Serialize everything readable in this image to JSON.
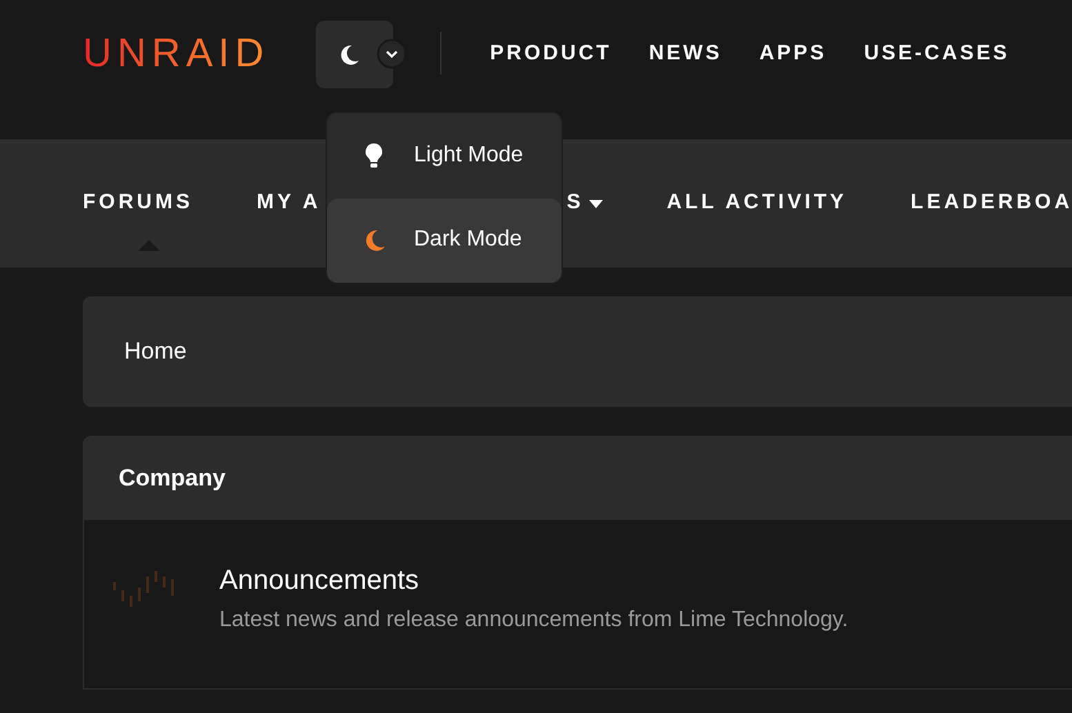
{
  "header": {
    "logo": "UNRAID",
    "nav": [
      "PRODUCT",
      "NEWS",
      "APPS",
      "USE-CASES"
    ]
  },
  "theme_menu": {
    "items": [
      {
        "kind": "light",
        "label": "Light Mode",
        "selected": false
      },
      {
        "kind": "dark",
        "label": "Dark Mode",
        "selected": true
      }
    ]
  },
  "subnav": [
    {
      "label_start": "FORUMS",
      "selected": true
    },
    {
      "label_start": "MY A",
      "label_end": "S",
      "caret": true,
      "selected": false
    },
    {
      "label_start": "ALL ACTIVITY",
      "selected": false
    },
    {
      "label_start": "LEADERBOA",
      "selected": false
    }
  ],
  "breadcrumb": "Home",
  "category": {
    "title": "Company",
    "forums": [
      {
        "name": "Announcements",
        "description": "Latest news and release announcements from Lime Technology."
      }
    ]
  }
}
